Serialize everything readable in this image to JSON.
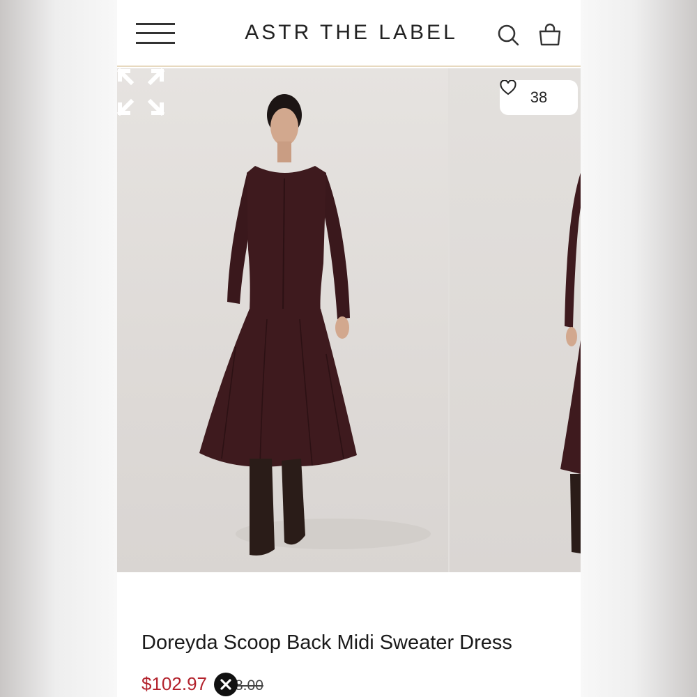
{
  "header": {
    "brand": "ASTR THE LABEL",
    "icons": [
      "menu-icon",
      "search-icon",
      "bag-icon"
    ]
  },
  "gallery": {
    "likes_count": "38",
    "icons": [
      "heart-icon",
      "expand-icon"
    ]
  },
  "product": {
    "title": "Doreyda Scoop Back Midi Sweater Dress",
    "sale_price": "$102.97",
    "original_price_visible": "8.00"
  },
  "overlay": {
    "icon": "close-icon"
  },
  "colors": {
    "dress": "#3e1a1e",
    "sale_price": "#b3222c",
    "header_border": "#e7d9bf",
    "photo_background": "#e2dfdc"
  }
}
